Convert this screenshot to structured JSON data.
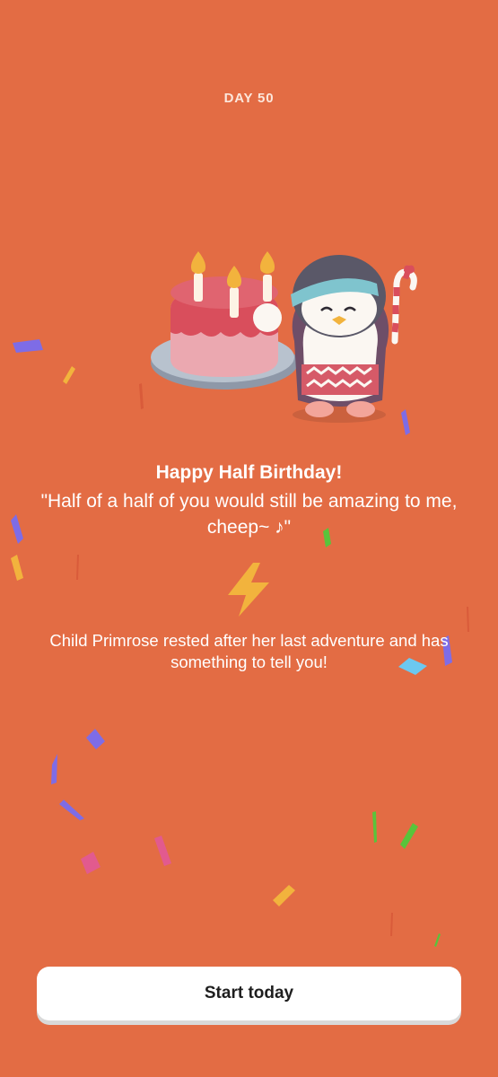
{
  "header": {
    "day_label": "DAY 50"
  },
  "illustration": {
    "icon": "birthday-cake-penguin-illustration"
  },
  "message": {
    "headline": "Happy Half Birthday!",
    "quote": "\"Half of a half of you would still be amazing to me, cheep~ ♪\"",
    "energy_icon": "lightning-bolt-icon",
    "story": "Child Primrose rested after her last adventure and has something to tell you!"
  },
  "footer": {
    "start_label": "Start today"
  },
  "colors": {
    "background": "#E36C44",
    "button": "#FFFFFF",
    "accent_yellow": "#F2B33D"
  }
}
